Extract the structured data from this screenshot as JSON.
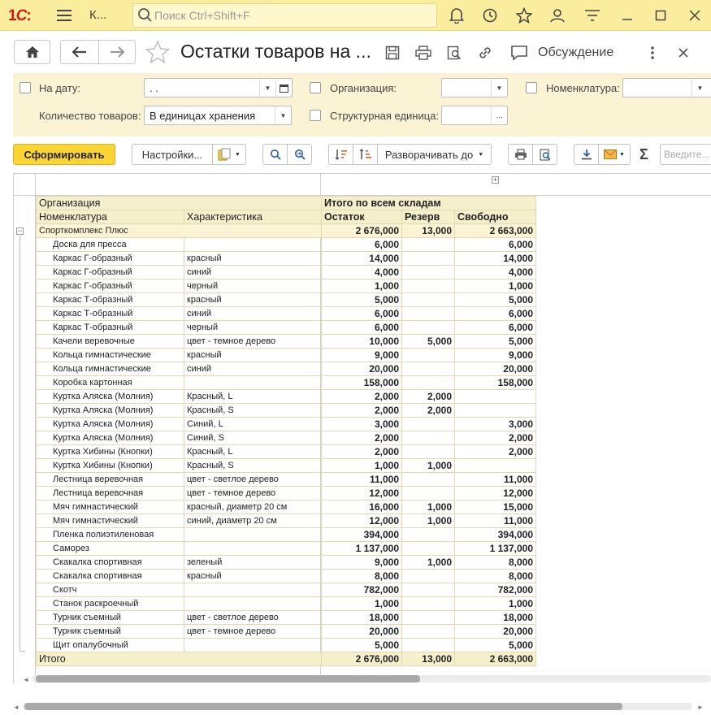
{
  "app": {
    "tab_title": "К...",
    "search_placeholder": "Поиск Ctrl+Shift+F"
  },
  "header": {
    "title": "Остатки товаров на ...",
    "discuss_label": "Обсуждение"
  },
  "filters": {
    "date_label": "На дату:",
    "date_value": " .  .",
    "org_label": "Организация:",
    "nom_label": "Номенклатура:",
    "qty_label": "Количество товаров:",
    "qty_value": "В единицах хранения",
    "unit_label": "Структурная единица:",
    "unit_btn": "..."
  },
  "toolbar": {
    "generate": "Сформировать",
    "settings": "Настройки...",
    "expand": "Разворачивать до",
    "input_placeholder": "Введите..."
  },
  "report": {
    "hdr_org": "Организация",
    "hdr_total_all": "Итого по всем складам",
    "hdr_nom": "Номенклатура",
    "hdr_char": "Характеристика",
    "hdr_stock": "Остаток",
    "hdr_reserve": "Резерв",
    "hdr_free": "Свободно",
    "expand_plus": "+",
    "collapse_minus": "−",
    "group": {
      "name": "Спорткомплекс Плюс",
      "stock": "2 676,000",
      "reserve": "13,000",
      "free": "2 663,000"
    },
    "rows": [
      {
        "nom": "Доска для пресса",
        "char": "",
        "stock": "6,000",
        "reserve": "",
        "free": "6,000"
      },
      {
        "nom": "Каркас Г-образный",
        "char": "красный",
        "stock": "14,000",
        "reserve": "",
        "free": "14,000"
      },
      {
        "nom": "Каркас Г-образный",
        "char": "синий",
        "stock": "4,000",
        "reserve": "",
        "free": "4,000"
      },
      {
        "nom": "Каркас Г-образный",
        "char": "черный",
        "stock": "1,000",
        "reserve": "",
        "free": "1,000"
      },
      {
        "nom": "Каркас Т-образный",
        "char": "красный",
        "stock": "5,000",
        "reserve": "",
        "free": "5,000"
      },
      {
        "nom": "Каркас Т-образный",
        "char": "синий",
        "stock": "6,000",
        "reserve": "",
        "free": "6,000"
      },
      {
        "nom": "Каркас Т-образный",
        "char": "черный",
        "stock": "6,000",
        "reserve": "",
        "free": "6,000"
      },
      {
        "nom": "Качели веревочные",
        "char": "цвет - темное дерево",
        "stock": "10,000",
        "reserve": "5,000",
        "free": "5,000"
      },
      {
        "nom": "Кольца гимнастические",
        "char": "красный",
        "stock": "9,000",
        "reserve": "",
        "free": "9,000"
      },
      {
        "nom": "Кольца гимнастические",
        "char": "синий",
        "stock": "20,000",
        "reserve": "",
        "free": "20,000"
      },
      {
        "nom": "Коробка картонная",
        "char": "",
        "stock": "158,000",
        "reserve": "",
        "free": "158,000"
      },
      {
        "nom": "Куртка Аляска (Молния)",
        "char": "Красный, L",
        "stock": "2,000",
        "reserve": "2,000",
        "free": ""
      },
      {
        "nom": "Куртка Аляска (Молния)",
        "char": "Красный, S",
        "stock": "2,000",
        "reserve": "2,000",
        "free": ""
      },
      {
        "nom": "Куртка Аляска (Молния)",
        "char": "Синий, L",
        "stock": "3,000",
        "reserve": "",
        "free": "3,000"
      },
      {
        "nom": "Куртка Аляска (Молния)",
        "char": "Синий, S",
        "stock": "2,000",
        "reserve": "",
        "free": "2,000"
      },
      {
        "nom": "Куртка Хибины (Кнопки)",
        "char": "Красный, L",
        "stock": "2,000",
        "reserve": "",
        "free": "2,000"
      },
      {
        "nom": "Куртка Хибины (Кнопки)",
        "char": "Красный, S",
        "stock": "1,000",
        "reserve": "1,000",
        "free": ""
      },
      {
        "nom": "Лестница веревочная",
        "char": "цвет - светлое дерево",
        "stock": "11,000",
        "reserve": "",
        "free": "11,000"
      },
      {
        "nom": "Лестница веревочная",
        "char": "цвет - темное дерево",
        "stock": "12,000",
        "reserve": "",
        "free": "12,000"
      },
      {
        "nom": "Мяч гимнастический",
        "char": "красный, диаметр 20 см",
        "stock": "16,000",
        "reserve": "1,000",
        "free": "15,000"
      },
      {
        "nom": "Мяч гимнастический",
        "char": "синий, диаметр 20 см",
        "stock": "12,000",
        "reserve": "1,000",
        "free": "11,000"
      },
      {
        "nom": "Пленка полиэтиленовая",
        "char": "",
        "stock": "394,000",
        "reserve": "",
        "free": "394,000"
      },
      {
        "nom": "Саморез",
        "char": "",
        "stock": "1 137,000",
        "reserve": "",
        "free": "1 137,000"
      },
      {
        "nom": "Скакалка спортивная",
        "char": "зеленый",
        "stock": "9,000",
        "reserve": "1,000",
        "free": "8,000"
      },
      {
        "nom": "Скакалка спортивная",
        "char": "красный",
        "stock": "8,000",
        "reserve": "",
        "free": "8,000"
      },
      {
        "nom": "Скотч",
        "char": "",
        "stock": "782,000",
        "reserve": "",
        "free": "782,000"
      },
      {
        "nom": "Станок раскроечный",
        "char": "",
        "stock": "1,000",
        "reserve": "",
        "free": "1,000"
      },
      {
        "nom": "Турник съемный",
        "char": "цвет - светлое дерево",
        "stock": "18,000",
        "reserve": "",
        "free": "18,000"
      },
      {
        "nom": "Турник съемный",
        "char": "цвет - темное дерево",
        "stock": "20,000",
        "reserve": "",
        "free": "20,000"
      },
      {
        "nom": "Щит опалубочный",
        "char": "",
        "stock": "5,000",
        "reserve": "",
        "free": "5,000"
      }
    ],
    "total": {
      "label": "Итого",
      "stock": "2 676,000",
      "reserve": "13,000",
      "free": "2 663,000"
    }
  },
  "colors": {
    "accent_yellow": "#fcd535",
    "topbar": "#fbed9e",
    "filter_panel": "#faf3d4",
    "header_cell": "#f6efcc",
    "logo_red": "#d11b1b"
  }
}
